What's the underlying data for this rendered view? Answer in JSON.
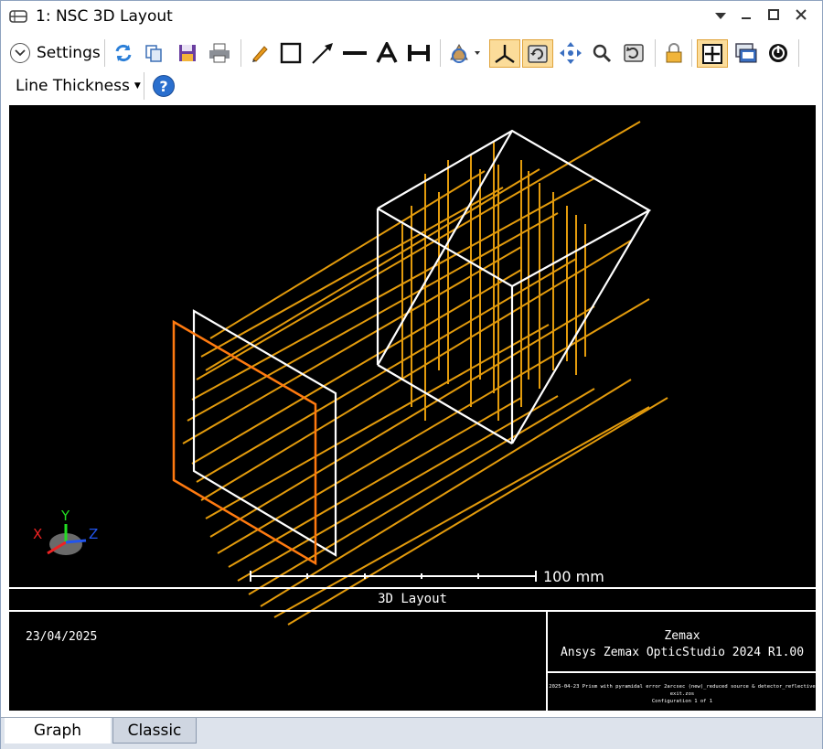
{
  "window": {
    "title": "1: NSC 3D Layout"
  },
  "toolbar": {
    "settings_label": "Settings",
    "line_thickness_label": "Line Thickness",
    "icons": [
      "refresh-icon",
      "copy-icon",
      "save-icon",
      "print-icon",
      "pencil-icon",
      "rectangle-icon",
      "arrow-icon",
      "line-icon",
      "text-icon",
      "dimension-icon",
      "rotate-icon",
      "axes-icon",
      "rotate-view-icon",
      "pan-icon",
      "zoom-icon",
      "reset-icon",
      "lock-icon",
      "fit-icon",
      "export-icon",
      "clock-icon"
    ]
  },
  "plot": {
    "scale_label": "100 mm",
    "axis_x": "X",
    "axis_y": "Y",
    "axis_z": "Z",
    "colors": {
      "rays": "#e39b0c",
      "geometry": "#ffffff",
      "detector": "#ff7a10"
    }
  },
  "footer": {
    "title": "3D Layout",
    "date": "23/04/2025",
    "brand_line1": "Zemax",
    "brand_line2": "Ansys Zemax OpticStudio 2024 R1.00",
    "file_line": "2025-04-23 Prism with pyramidal error 2arcsec (new)_reduced source & detector_reflective exit.zos",
    "config_line": "Configuration 1 of 1"
  },
  "tabs": {
    "graph": "Graph",
    "classic": "Classic"
  }
}
